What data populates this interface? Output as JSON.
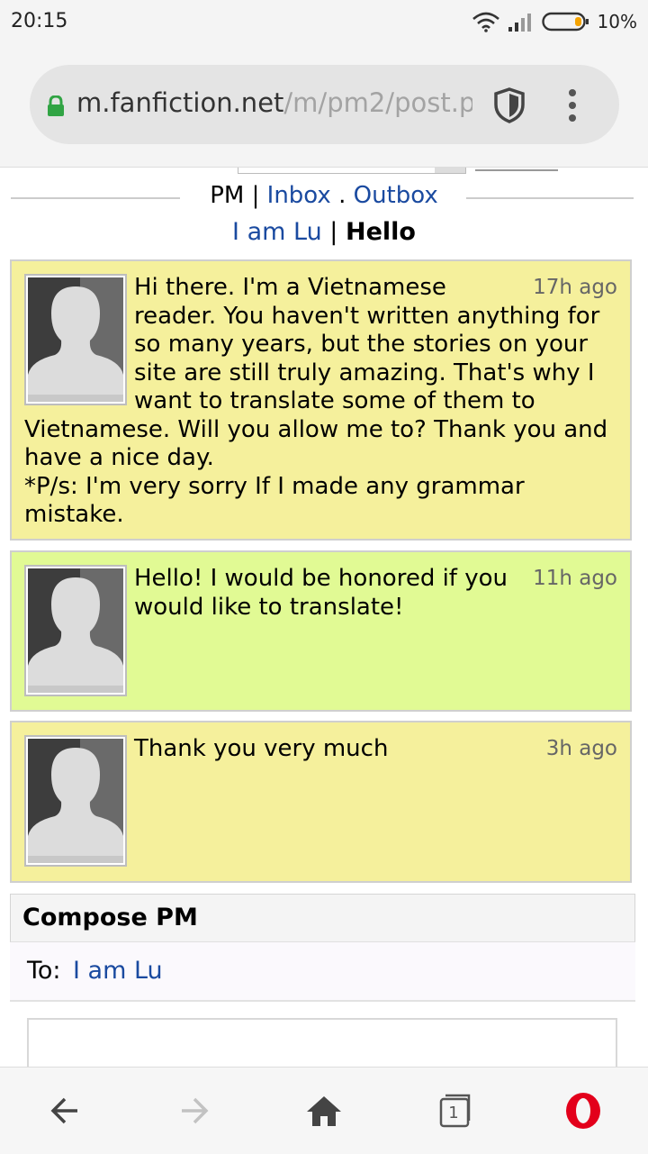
{
  "status_bar": {
    "time": "20:15",
    "battery": "10%"
  },
  "browser": {
    "url_host": "m.fanfiction.net",
    "url_path": "/m/pm2/post.p"
  },
  "pm_nav": {
    "pm": "PM",
    "sep1": "|",
    "inbox": "Inbox",
    "dot": ".",
    "outbox": "Outbox"
  },
  "thread": {
    "user": "I am Lu",
    "sep": "|",
    "subject": "Hello"
  },
  "messages": [
    {
      "time": "17h ago",
      "lines": [
        "Hi there. I'm a Vietnamese reader. You haven't written anything for so many years, but the stories on your site are still truly amazing. That's why I want to translate some of them to Vietnamese. Will you allow me to? Thank you and have a nice day.",
        "*P/s:  I'm very sorry If I made any grammar mistake."
      ]
    },
    {
      "time": "11h ago",
      "lines": [
        "Hello! I would be honored if you would like to translate!"
      ]
    },
    {
      "time": "3h ago",
      "lines": [
        "Thank you very much"
      ]
    }
  ],
  "compose": {
    "title": "Compose PM",
    "to_label": "To:",
    "to_value": "I am Lu"
  },
  "bottom_bar": {
    "tab_count": "1"
  },
  "colors": {
    "msg_yellow": "#f5f09c",
    "msg_green": "#e1fa94",
    "link": "#1a4aa0",
    "opera_red": "#e3001b"
  },
  "icons": [
    "wifi-icon",
    "signal-icon",
    "battery-icon",
    "lock-icon",
    "shield-icon",
    "menu-dots-icon",
    "back-arrow-icon",
    "forward-arrow-icon",
    "home-icon",
    "tabs-icon",
    "opera-icon"
  ]
}
